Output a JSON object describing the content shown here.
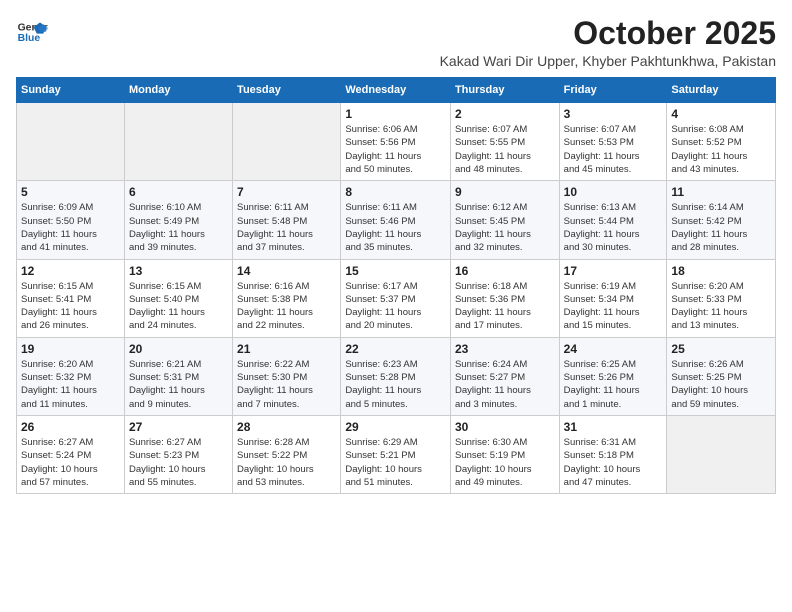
{
  "header": {
    "logo": {
      "line1": "General",
      "line2": "Blue"
    },
    "month": "October 2025",
    "location": "Kakad Wari Dir Upper, Khyber Pakhtunkhwa, Pakistan"
  },
  "days_of_week": [
    "Sunday",
    "Monday",
    "Tuesday",
    "Wednesday",
    "Thursday",
    "Friday",
    "Saturday"
  ],
  "weeks": [
    [
      {
        "day": "",
        "content": ""
      },
      {
        "day": "",
        "content": ""
      },
      {
        "day": "",
        "content": ""
      },
      {
        "day": "1",
        "content": "Sunrise: 6:06 AM\nSunset: 5:56 PM\nDaylight: 11 hours\nand 50 minutes."
      },
      {
        "day": "2",
        "content": "Sunrise: 6:07 AM\nSunset: 5:55 PM\nDaylight: 11 hours\nand 48 minutes."
      },
      {
        "day": "3",
        "content": "Sunrise: 6:07 AM\nSunset: 5:53 PM\nDaylight: 11 hours\nand 45 minutes."
      },
      {
        "day": "4",
        "content": "Sunrise: 6:08 AM\nSunset: 5:52 PM\nDaylight: 11 hours\nand 43 minutes."
      }
    ],
    [
      {
        "day": "5",
        "content": "Sunrise: 6:09 AM\nSunset: 5:50 PM\nDaylight: 11 hours\nand 41 minutes."
      },
      {
        "day": "6",
        "content": "Sunrise: 6:10 AM\nSunset: 5:49 PM\nDaylight: 11 hours\nand 39 minutes."
      },
      {
        "day": "7",
        "content": "Sunrise: 6:11 AM\nSunset: 5:48 PM\nDaylight: 11 hours\nand 37 minutes."
      },
      {
        "day": "8",
        "content": "Sunrise: 6:11 AM\nSunset: 5:46 PM\nDaylight: 11 hours\nand 35 minutes."
      },
      {
        "day": "9",
        "content": "Sunrise: 6:12 AM\nSunset: 5:45 PM\nDaylight: 11 hours\nand 32 minutes."
      },
      {
        "day": "10",
        "content": "Sunrise: 6:13 AM\nSunset: 5:44 PM\nDaylight: 11 hours\nand 30 minutes."
      },
      {
        "day": "11",
        "content": "Sunrise: 6:14 AM\nSunset: 5:42 PM\nDaylight: 11 hours\nand 28 minutes."
      }
    ],
    [
      {
        "day": "12",
        "content": "Sunrise: 6:15 AM\nSunset: 5:41 PM\nDaylight: 11 hours\nand 26 minutes."
      },
      {
        "day": "13",
        "content": "Sunrise: 6:15 AM\nSunset: 5:40 PM\nDaylight: 11 hours\nand 24 minutes."
      },
      {
        "day": "14",
        "content": "Sunrise: 6:16 AM\nSunset: 5:38 PM\nDaylight: 11 hours\nand 22 minutes."
      },
      {
        "day": "15",
        "content": "Sunrise: 6:17 AM\nSunset: 5:37 PM\nDaylight: 11 hours\nand 20 minutes."
      },
      {
        "day": "16",
        "content": "Sunrise: 6:18 AM\nSunset: 5:36 PM\nDaylight: 11 hours\nand 17 minutes."
      },
      {
        "day": "17",
        "content": "Sunrise: 6:19 AM\nSunset: 5:34 PM\nDaylight: 11 hours\nand 15 minutes."
      },
      {
        "day": "18",
        "content": "Sunrise: 6:20 AM\nSunset: 5:33 PM\nDaylight: 11 hours\nand 13 minutes."
      }
    ],
    [
      {
        "day": "19",
        "content": "Sunrise: 6:20 AM\nSunset: 5:32 PM\nDaylight: 11 hours\nand 11 minutes."
      },
      {
        "day": "20",
        "content": "Sunrise: 6:21 AM\nSunset: 5:31 PM\nDaylight: 11 hours\nand 9 minutes."
      },
      {
        "day": "21",
        "content": "Sunrise: 6:22 AM\nSunset: 5:30 PM\nDaylight: 11 hours\nand 7 minutes."
      },
      {
        "day": "22",
        "content": "Sunrise: 6:23 AM\nSunset: 5:28 PM\nDaylight: 11 hours\nand 5 minutes."
      },
      {
        "day": "23",
        "content": "Sunrise: 6:24 AM\nSunset: 5:27 PM\nDaylight: 11 hours\nand 3 minutes."
      },
      {
        "day": "24",
        "content": "Sunrise: 6:25 AM\nSunset: 5:26 PM\nDaylight: 11 hours\nand 1 minute."
      },
      {
        "day": "25",
        "content": "Sunrise: 6:26 AM\nSunset: 5:25 PM\nDaylight: 10 hours\nand 59 minutes."
      }
    ],
    [
      {
        "day": "26",
        "content": "Sunrise: 6:27 AM\nSunset: 5:24 PM\nDaylight: 10 hours\nand 57 minutes."
      },
      {
        "day": "27",
        "content": "Sunrise: 6:27 AM\nSunset: 5:23 PM\nDaylight: 10 hours\nand 55 minutes."
      },
      {
        "day": "28",
        "content": "Sunrise: 6:28 AM\nSunset: 5:22 PM\nDaylight: 10 hours\nand 53 minutes."
      },
      {
        "day": "29",
        "content": "Sunrise: 6:29 AM\nSunset: 5:21 PM\nDaylight: 10 hours\nand 51 minutes."
      },
      {
        "day": "30",
        "content": "Sunrise: 6:30 AM\nSunset: 5:19 PM\nDaylight: 10 hours\nand 49 minutes."
      },
      {
        "day": "31",
        "content": "Sunrise: 6:31 AM\nSunset: 5:18 PM\nDaylight: 10 hours\nand 47 minutes."
      },
      {
        "day": "",
        "content": ""
      }
    ]
  ]
}
